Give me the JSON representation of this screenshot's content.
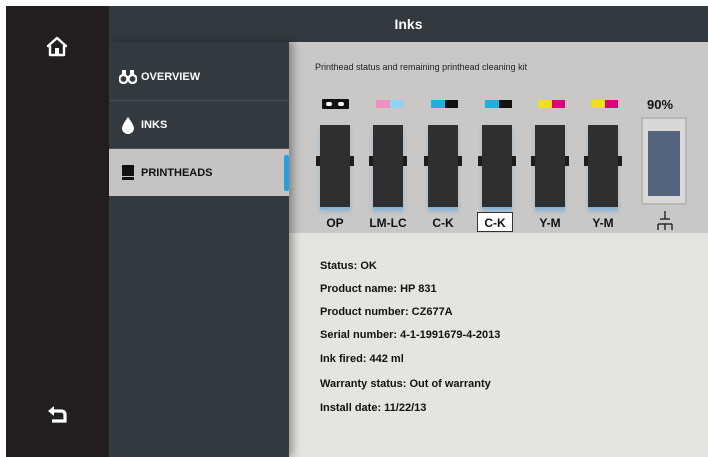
{
  "header": {
    "title": "Inks"
  },
  "left_bar": {
    "home": "home-icon",
    "back": "back-arrow-icon"
  },
  "sidebar": {
    "items": [
      {
        "label": "OVERVIEW",
        "icon": "binoculars-icon"
      },
      {
        "label": "INKS",
        "icon": "ink-drop-icon"
      },
      {
        "label": "PRINTHEADS",
        "icon": "printhead-icon",
        "selected": true
      }
    ]
  },
  "panel": {
    "subtitle": "Printhead status and remaining printhead cleaning kit",
    "printheads": [
      {
        "label": "OP",
        "colors": [
          "#ffffff",
          "#ffffff"
        ]
      },
      {
        "label": "LM-LC",
        "colors": [
          "#f08fc0",
          "#8fd5f0"
        ]
      },
      {
        "label": "C-K",
        "colors": [
          "#1fb0e0",
          "#111111"
        ]
      },
      {
        "label": "C-K",
        "colors": [
          "#1fb0e0",
          "#111111"
        ],
        "selected": true
      },
      {
        "label": "Y-M",
        "colors": [
          "#f0e020",
          "#e0007a"
        ]
      },
      {
        "label": "Y-M",
        "colors": [
          "#f0e020",
          "#e0007a"
        ]
      }
    ],
    "cleaning_kit": {
      "percent": "90%",
      "level": 0.9,
      "icon": "cleaning-kit-icon"
    }
  },
  "details": {
    "status": "Status: OK",
    "product_name": "Product name:  HP 831",
    "product_number": "Product number:   CZ677A",
    "serial_number": "Serial number:   4-1-1991679-4-2013",
    "ink_fired": "Ink fired:    442 ml",
    "warranty": "Warranty status:   Out of warranty",
    "install_date": "Install date:  11/22/13"
  },
  "colors": {
    "selection_accent": "#2a9de0",
    "sidebar_bg": "#333a3f",
    "kit_fill": "#53647e"
  }
}
